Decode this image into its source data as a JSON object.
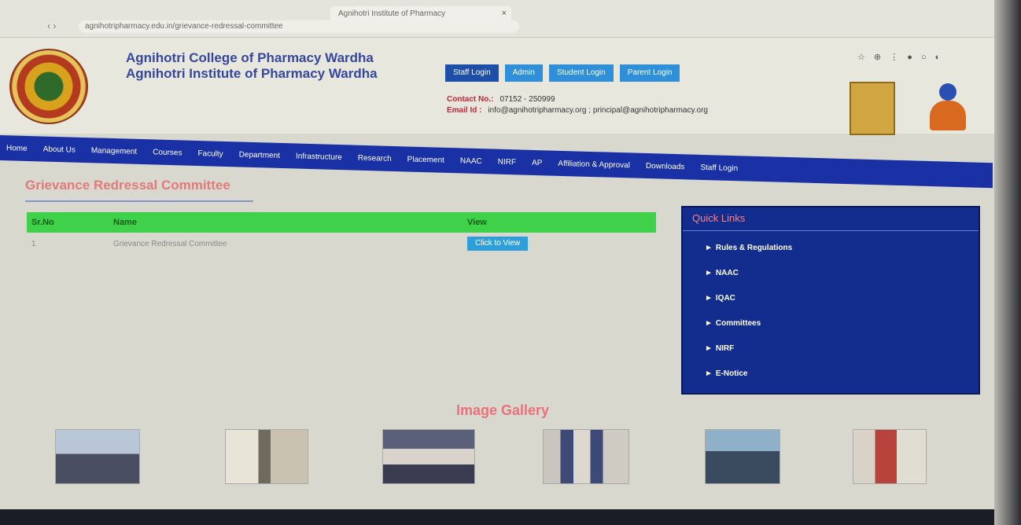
{
  "browser": {
    "tab_title": "Agnihotri Institute of Pharmacy",
    "tab_close": "×",
    "nav_arrows": "‹ ›",
    "url": "agnihotripharmacy.edu.in/grievance-redressal-committee",
    "extensions": "☆ ⊕ ⋮ ● ○ ◐"
  },
  "header": {
    "college_name_1": "Agnihotri College of Pharmacy Wardha",
    "college_name_2": "Agnihotri Institute of Pharmacy Wardha",
    "buttons": [
      "Staff Login",
      "Admin",
      "Student Login",
      "Parent Login"
    ],
    "contact_label": "Contact No.:",
    "contact_value": "07152 - 250999",
    "email_label": "Email Id :",
    "email_value": "info@agnihotripharmacy.org ; principal@agnihotripharmacy.org"
  },
  "nav": {
    "items": [
      "Home",
      "About Us",
      "Management",
      "Courses",
      "Faculty",
      "Department",
      "Infrastructure",
      "Research",
      "Placement",
      "NAAC",
      "NIRF",
      "AP",
      "Affiliation & Approval",
      "Downloads",
      "Staff Login"
    ]
  },
  "main": {
    "heading": "Grievance Redressal Committee",
    "table": {
      "headers": [
        "Sr.No",
        "Name",
        "View"
      ],
      "rows": [
        {
          "sr": "1",
          "name": "Grievance Redressal Committee",
          "action": "Click to View"
        }
      ]
    }
  },
  "quick_links": {
    "title": "Quick Links",
    "arrow": "►",
    "items": [
      "Rules & Regulations",
      "NAAC",
      "IQAC",
      "Committees",
      "NIRF",
      "E-Notice"
    ]
  },
  "gallery": {
    "title": "Image Gallery"
  },
  "colors": {
    "nav_blue": "#1a31a6",
    "table_header_green": "#3fd14a",
    "quick_links_bg": "#132d8e",
    "heading_pink": "#e27a7a"
  }
}
